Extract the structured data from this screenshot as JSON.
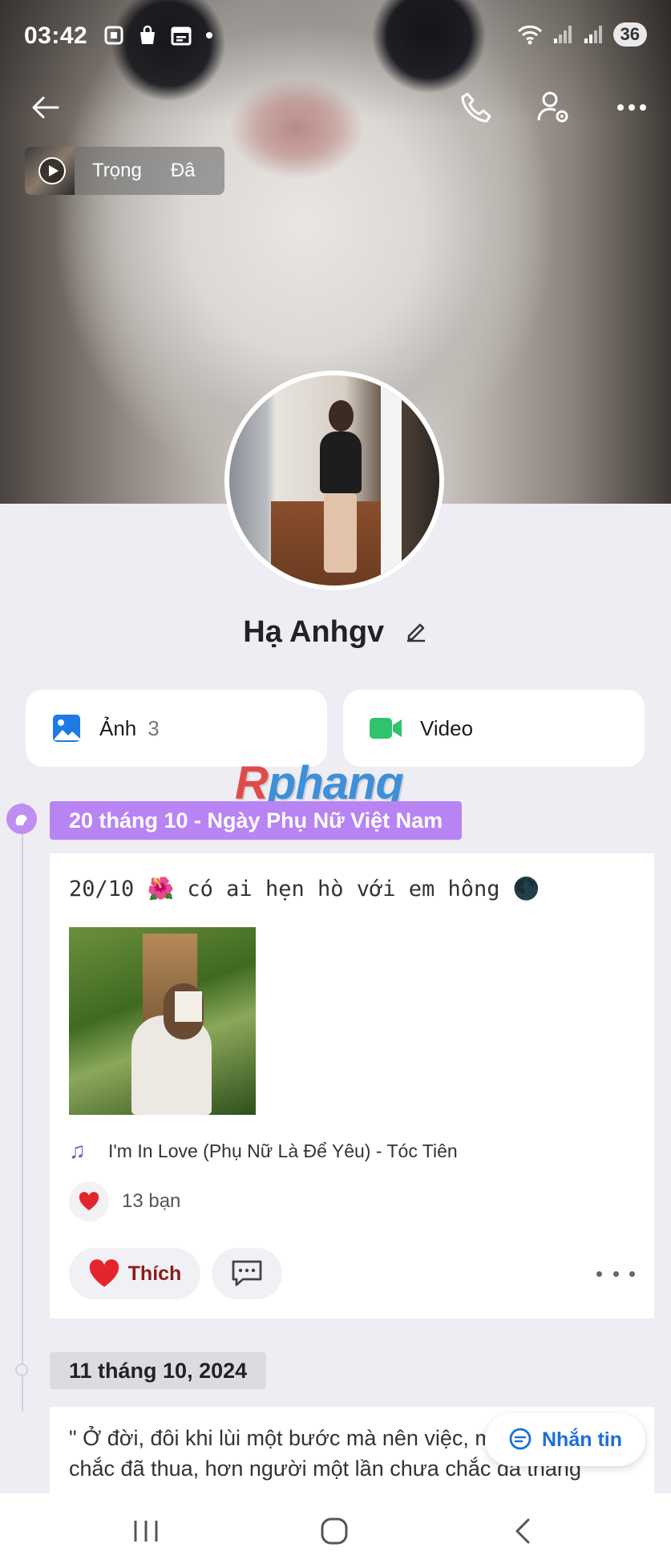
{
  "status_bar": {
    "time": "03:42",
    "battery": "36",
    "icons_left": [
      "screenshot-icon",
      "bag-icon",
      "calendar-icon",
      "dot-icon"
    ],
    "icons_right": [
      "wifi-icon",
      "signal-icon",
      "signal-icon"
    ]
  },
  "header": {
    "back_icon": "arrow-left-icon",
    "call_icon": "phone-icon",
    "settings_icon": "user-settings-icon",
    "more_icon": "more-horizontal-icon"
  },
  "music": {
    "label_1": "Trọng",
    "label_2": "Đâ"
  },
  "profile": {
    "name": "Hạ Anhgv"
  },
  "media": {
    "photos_label": "Ảnh",
    "photos_count": "3",
    "video_label": "Video"
  },
  "watermark": {
    "r": "R",
    "rest": "phang"
  },
  "timeline": {
    "event_label": "20 tháng 10 - Ngày Phụ Nữ Việt Nam",
    "date_label": "11 tháng 10, 2024"
  },
  "post": {
    "text": "20/10 🌺 có ai hẹn hò với em hông 🌑",
    "song": "I'm In Love (Phụ Nữ Là Để Yêu) - Tóc Tiên",
    "reactions": "13 bạn",
    "like_label": "Thích"
  },
  "post2": {
    "text": "\" Ở đời, đôi khi lùi một bước mà nên việc, một lần chưa chắc đã thua, hơn người một lần chưa chắc đã thắng \""
  },
  "message_button": {
    "label": "Nhắn tin"
  },
  "colors": {
    "accent_purple": "#b884f4",
    "message_blue": "#1b6fd8",
    "video_green": "#2fc46b",
    "photo_blue": "#1e7be6",
    "like_red": "#e3262d"
  }
}
